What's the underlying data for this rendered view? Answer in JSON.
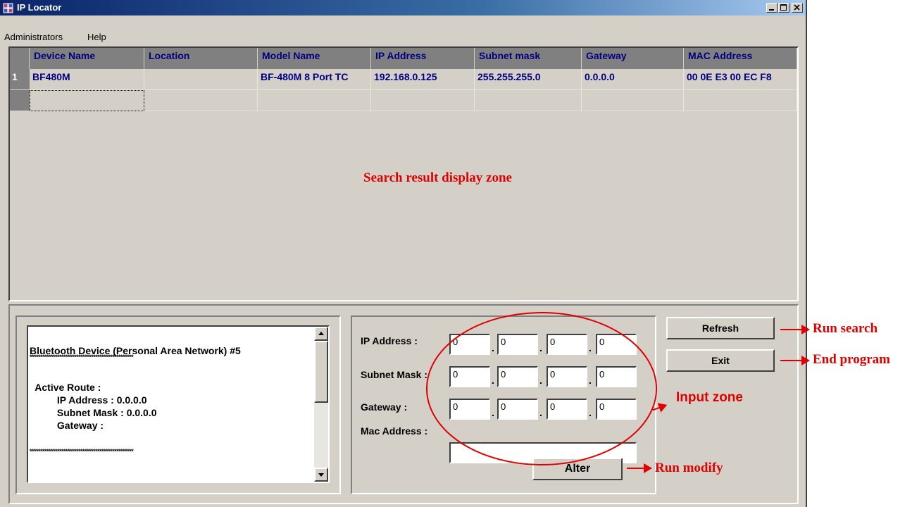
{
  "window": {
    "title": "IP Locator"
  },
  "menu": {
    "items": [
      {
        "label": "Administrators"
      },
      {
        "label": "Help"
      }
    ]
  },
  "grid": {
    "columns": [
      "Device Name",
      "Location",
      "Model Name",
      "IP Address",
      "Subnet mask",
      "Gateway",
      "MAC Address"
    ],
    "rows": [
      {
        "num": "1",
        "cells": [
          "BF480M",
          "",
          "BF-480M 8 Port TC",
          "192.168.0.125",
          "255.255.255.0",
          "0.0.0.0",
          "00 0E E3 00 EC F8"
        ]
      }
    ],
    "zone_label": "Search result display zone"
  },
  "route_text": {
    "lines": [
      "Bluetooth Device (Personal Area Network) #5",
      "*************************************************",
      "",
      "  Active Route :",
      "          IP Address : 0.0.0.0",
      "          Subnet Mask : 0.0.0.0",
      "          Gateway :",
      "",
      "*************************************************"
    ]
  },
  "form": {
    "ip_label": "IP Address :",
    "subnet_label": "Subnet Mask :",
    "gateway_label": "Gateway :",
    "mac_label": "Mac Address :",
    "ip": [
      "0",
      "0",
      "0",
      "0"
    ],
    "subnet": [
      "0",
      "0",
      "0",
      "0"
    ],
    "gateway": [
      "0",
      "0",
      "0",
      "0"
    ],
    "mac": "",
    "dot": "."
  },
  "buttons": {
    "refresh": "Refresh",
    "exit": "Exit",
    "alter": "Alter"
  },
  "annotations": {
    "run_search": "Run search",
    "end_program": "End program",
    "input_zone": "Input zone",
    "run_modify": "Run modify"
  },
  "colors": {
    "annotation": "#e00000",
    "title_bar": "#0a246a",
    "grid_text": "#000080"
  }
}
